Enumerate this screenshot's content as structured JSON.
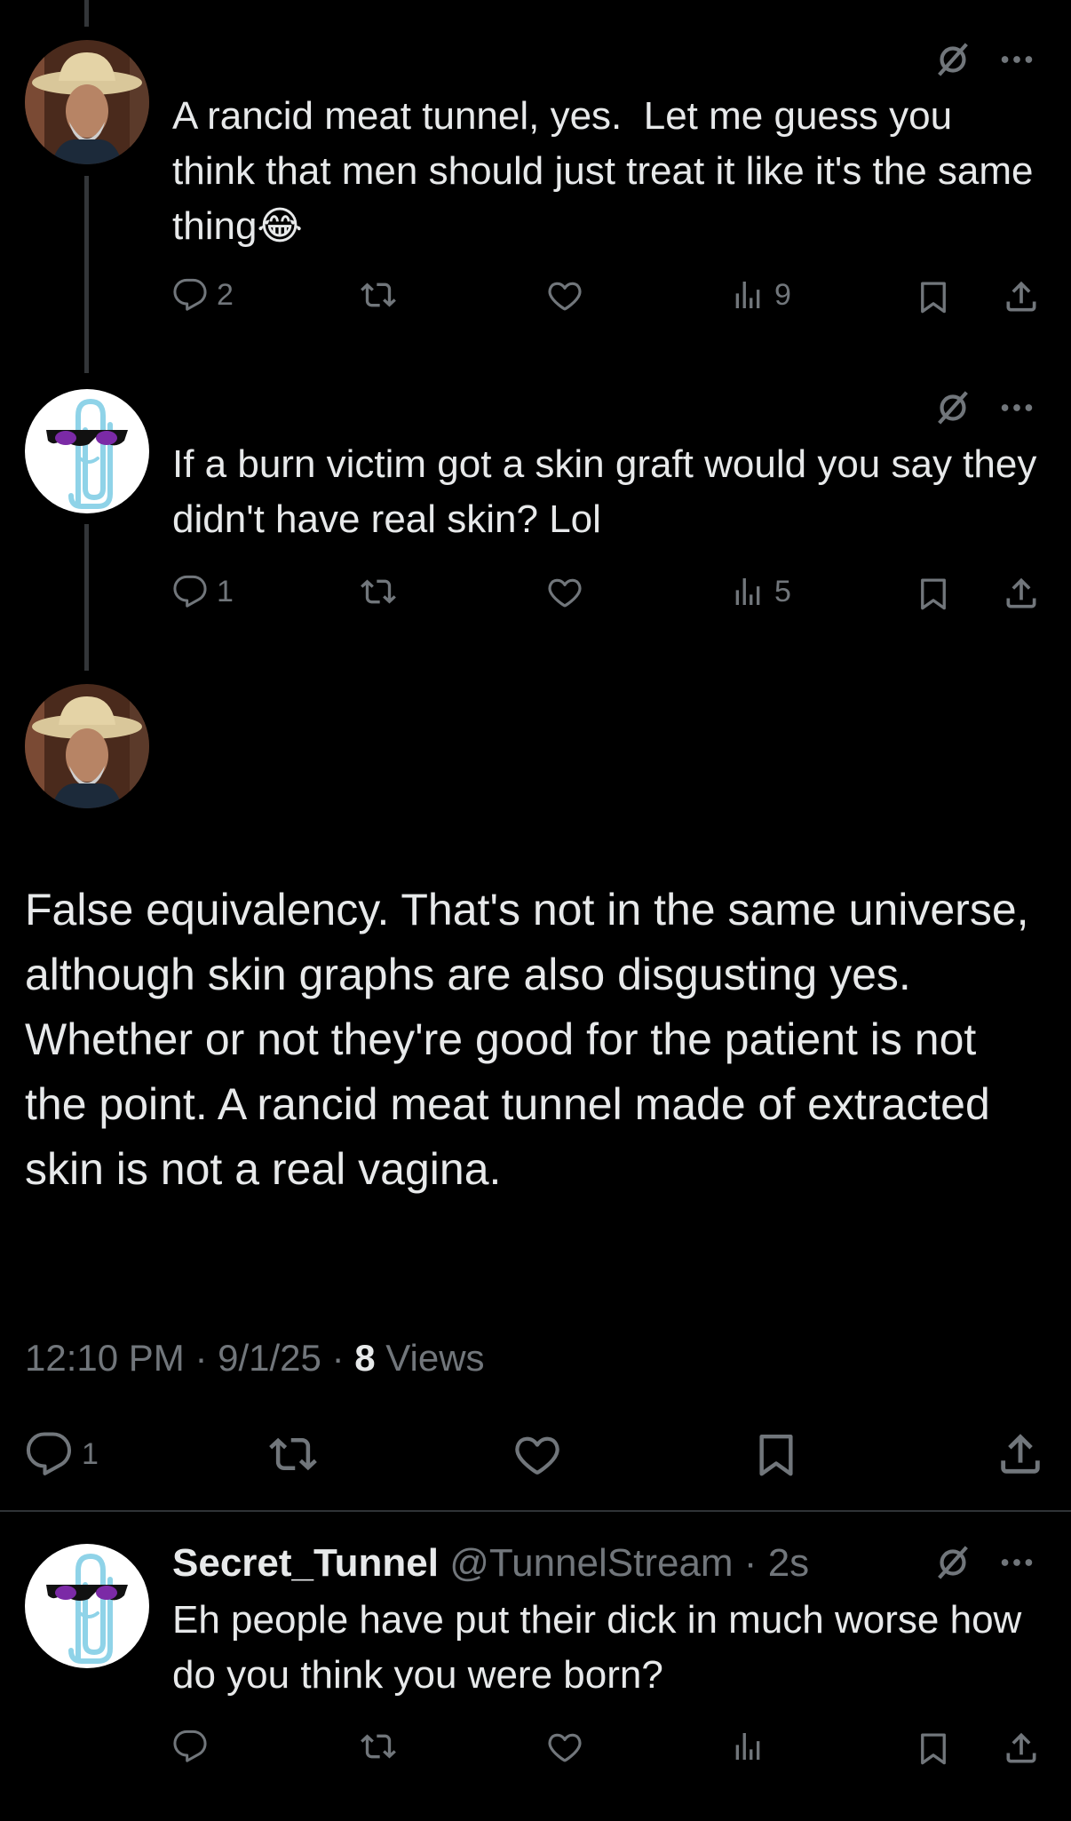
{
  "posts": [
    {
      "text": "A rancid meat tunnel, yes.  Let me guess you think that men should just treat it like it's the same thing😂",
      "replies": "2",
      "views": "9"
    },
    {
      "text": "If a burn victim got a skin graft would you say they didn't have real skin? Lol",
      "replies": "1",
      "views": "5"
    }
  ],
  "main_post": {
    "text": "False equivalency. That's not in the same universe, although skin graphs are also disgusting yes. Whether or not they're good for the patient is not the point. A rancid meat tunnel made of extracted skin is not a real vagina.",
    "time": "12:10 PM",
    "date": "9/1/25",
    "views_count": "8",
    "views_label": "Views",
    "replies": "1"
  },
  "reply": {
    "display_name": "Secret_Tunnel",
    "handle": "@TunnelStream",
    "time": "2s",
    "text": "Eh people have put their dick in much worse how do you think you were born?"
  },
  "icons": {
    "reply": "reply-icon",
    "repost": "repost-icon",
    "like": "like-icon",
    "views": "views-icon",
    "bookmark": "bookmark-icon",
    "share": "share-icon",
    "grok": "grok-icon",
    "more": "more-icon"
  },
  "colors": {
    "background": "#000000",
    "text": "#e7e9ea",
    "muted": "#71767b",
    "divider": "#2f3336"
  }
}
